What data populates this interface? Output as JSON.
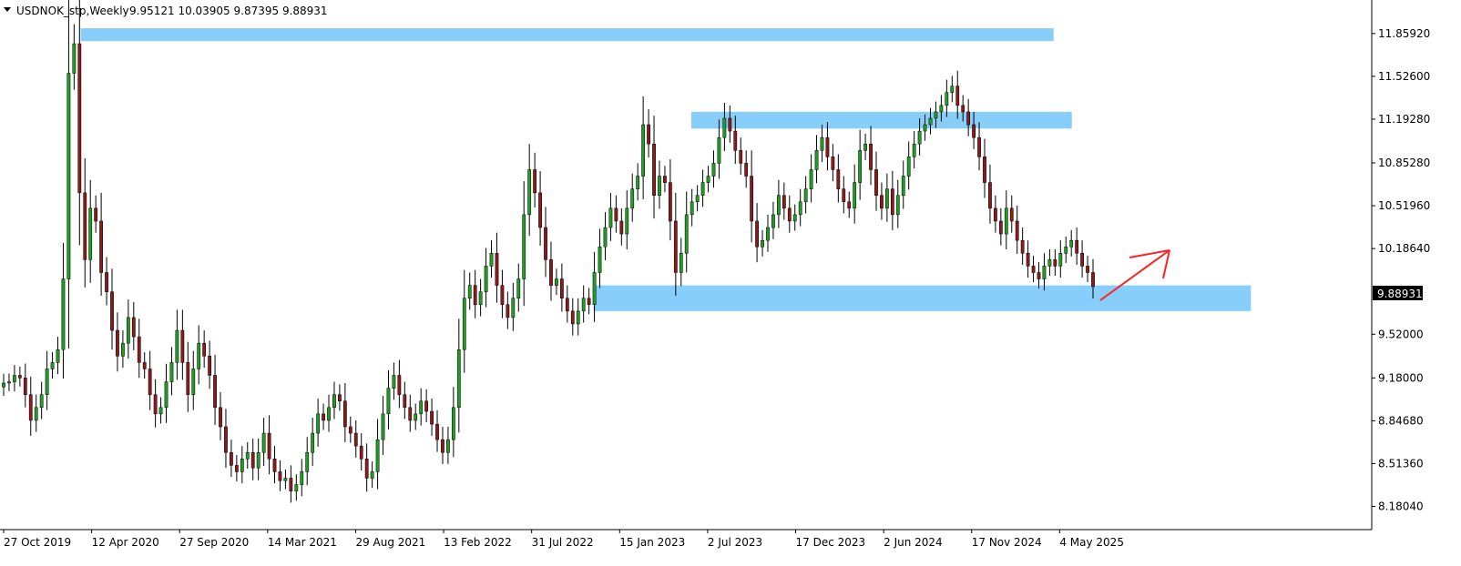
{
  "header": {
    "symbol": "USDNOK_stp,Weekly",
    "ohlc": "9.95121 10.03905 9.87395 9.88931"
  },
  "colors": {
    "bull": "#1f9d24",
    "bear": "#8b1a1a",
    "wick": "#000000",
    "zone": "#87cefa",
    "arrow": "#ff2020",
    "price_tag_bg": "#000000",
    "price_tag_text": "#ffffff"
  },
  "current_price_label": "9.88931",
  "chart_data": {
    "type": "candlestick",
    "title": "",
    "ylim": [
      8.0,
      12.12
    ],
    "y_ticks": [
      "11.85920",
      "11.52600",
      "11.19280",
      "10.85280",
      "10.51960",
      "10.18640",
      "9.52000",
      "9.18000",
      "8.84680",
      "8.51360",
      "8.18040"
    ],
    "x_ticks": [
      "27 Oct 2019",
      "12 Apr 2020",
      "27 Sep 2020",
      "14 Mar 2021",
      "29 Aug 2021",
      "13 Feb 2022",
      "31 Jul 2022",
      "15 Jan 2023",
      "2 Jul 2023",
      "17 Dec 2023",
      "2 Jun 2024",
      "17 Nov 2024",
      "4 May 2025"
    ],
    "series_close": [
      9.14,
      9.15,
      9.2,
      9.18,
      9.05,
      8.85,
      8.95,
      9.05,
      9.25,
      9.3,
      9.4,
      9.95,
      11.55,
      11.78,
      10.62,
      10.1,
      10.5,
      10.4,
      10.0,
      9.85,
      9.55,
      9.35,
      9.45,
      9.65,
      9.5,
      9.3,
      9.25,
      9.05,
      8.9,
      8.95,
      9.15,
      9.3,
      9.55,
      9.3,
      9.05,
      9.25,
      9.45,
      9.35,
      9.2,
      8.95,
      8.8,
      8.6,
      8.5,
      8.45,
      8.55,
      8.6,
      8.48,
      8.6,
      8.75,
      8.55,
      8.45,
      8.38,
      8.4,
      8.3,
      8.35,
      8.45,
      8.6,
      8.75,
      8.9,
      8.85,
      8.95,
      9.05,
      9.0,
      8.8,
      8.75,
      8.65,
      8.55,
      8.4,
      8.45,
      8.7,
      8.9,
      9.1,
      9.2,
      9.05,
      8.95,
      8.85,
      8.9,
      9.0,
      8.92,
      8.82,
      8.7,
      8.6,
      8.7,
      8.95,
      9.4,
      9.8,
      9.9,
      9.75,
      9.85,
      10.05,
      10.15,
      9.9,
      9.75,
      9.65,
      9.8,
      9.95,
      10.45,
      10.8,
      10.62,
      10.35,
      10.1,
      9.9,
      9.95,
      9.8,
      9.7,
      9.6,
      9.7,
      9.8,
      9.75,
      10.0,
      10.2,
      10.35,
      10.5,
      10.4,
      10.3,
      10.5,
      10.65,
      10.75,
      11.15,
      11.0,
      10.6,
      10.75,
      10.7,
      10.4,
      10.0,
      10.15,
      10.45,
      10.55,
      10.6,
      10.7,
      10.75,
      10.85,
      11.05,
      11.2,
      11.1,
      10.95,
      10.85,
      10.75,
      10.4,
      10.2,
      10.25,
      10.35,
      10.45,
      10.6,
      10.5,
      10.4,
      10.45,
      10.55,
      10.65,
      10.8,
      10.95,
      11.05,
      10.9,
      10.8,
      10.65,
      10.55,
      10.5,
      10.7,
      10.95,
      11.0,
      10.8,
      10.6,
      10.5,
      10.65,
      10.45,
      10.6,
      10.75,
      10.9,
      11.0,
      11.1,
      11.15,
      11.2,
      11.25,
      11.3,
      11.4,
      11.45,
      11.3,
      11.25,
      11.15,
      11.05,
      10.9,
      10.7,
      10.5,
      10.4,
      10.3,
      10.5,
      10.4,
      10.25,
      10.15,
      10.05,
      10.0,
      9.95,
      10.05,
      10.1,
      10.05,
      10.15,
      10.2,
      10.25,
      10.15,
      10.05,
      10.0,
      9.89
    ]
  },
  "zones": [
    {
      "from_date": "12 Apr 2020",
      "to_date": "17 Nov 2024",
      "price_top": 11.9,
      "price_bottom": 11.8
    },
    {
      "from_date": "2 Jul 2023",
      "to_date": "17 Nov 2024",
      "price_top": 11.25,
      "price_bottom": 11.12
    },
    {
      "from_date": "31 Jul 2022",
      "to_date": "4 May 2025",
      "price_top": 9.9,
      "price_bottom": 9.7
    }
  ]
}
